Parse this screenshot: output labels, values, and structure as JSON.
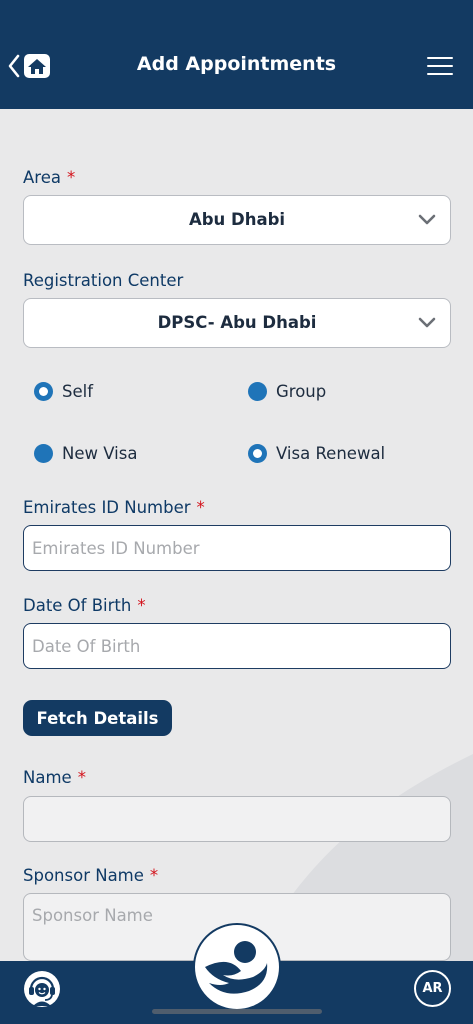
{
  "header": {
    "title": "Add Appointments"
  },
  "form": {
    "area": {
      "label": "Area",
      "required": "*",
      "value": "Abu Dhabi"
    },
    "registration_center": {
      "label": "Registration Center",
      "value": "DPSC- Abu Dhabi"
    },
    "applicant_type": {
      "options": [
        {
          "label": "Self",
          "selected": true
        },
        {
          "label": "Group",
          "selected": false
        }
      ]
    },
    "visa_type": {
      "options": [
        {
          "label": "New Visa",
          "selected": false
        },
        {
          "label": "Visa Renewal",
          "selected": true
        }
      ]
    },
    "emirates_id": {
      "label": "Emirates ID Number",
      "required": "*",
      "placeholder": "Emirates ID Number",
      "value": ""
    },
    "dob": {
      "label": "Date Of Birth",
      "required": "*",
      "placeholder": "Date Of Birth",
      "value": ""
    },
    "fetch_label": "Fetch Details",
    "name": {
      "label": "Name",
      "required": "*",
      "placeholder": "",
      "value": ""
    },
    "sponsor_name": {
      "label": "Sponsor Name",
      "required": "*",
      "placeholder": "Sponsor Name",
      "value": ""
    }
  },
  "bottom": {
    "language_label": "AR"
  },
  "icons": [
    "back-home-icon",
    "menu-icon",
    "chevron-down-icon",
    "support-agent-icon",
    "app-logo-icon"
  ],
  "colors": {
    "primary": "#133a62",
    "radio": "#1f74b8",
    "required": "#d3131c",
    "background": "#e9e9ea"
  }
}
